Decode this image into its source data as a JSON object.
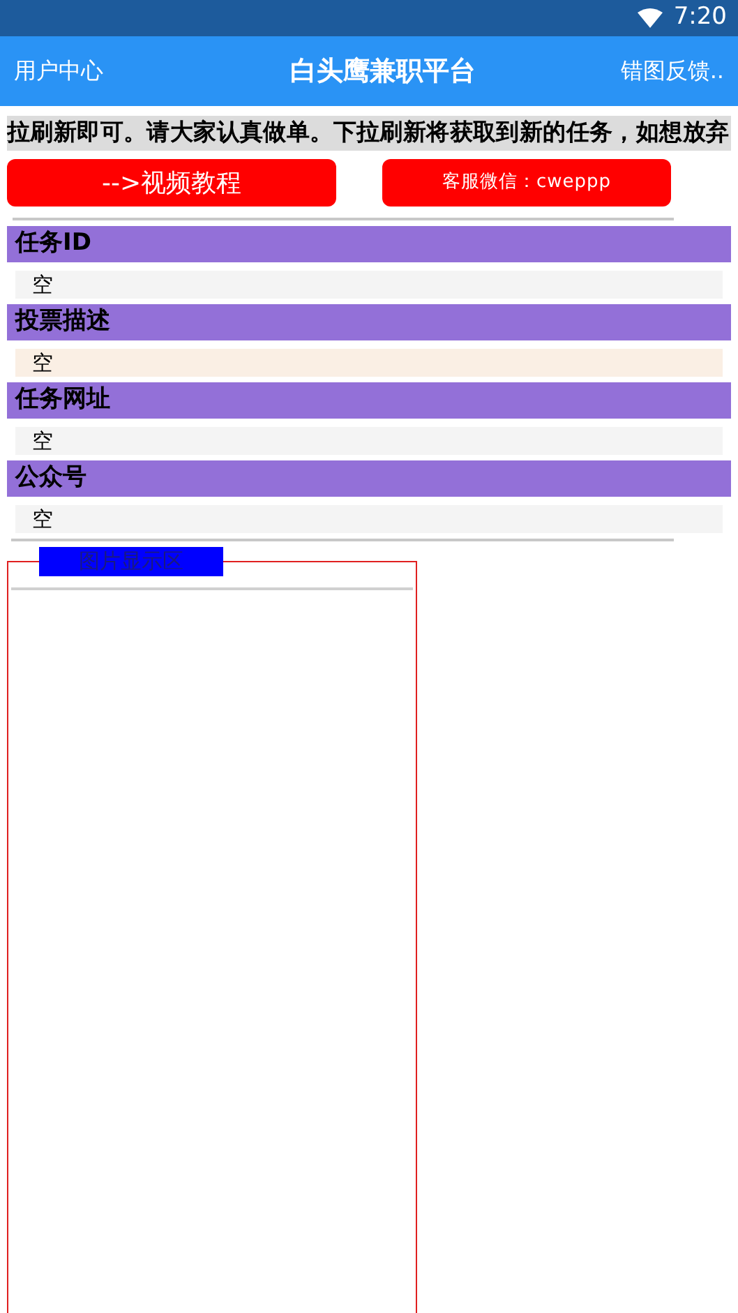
{
  "status_bar": {
    "time": "7:20"
  },
  "app_bar": {
    "left": "用户中心",
    "title": "白头鹰兼职平台",
    "right": "错图反馈.."
  },
  "notice": "拉刷新即可。请大家认真做单。下拉刷新将获取到新的任务，如想放弃",
  "buttons": [
    {
      "label": "-->视频教程",
      "kind": "large"
    },
    {
      "label": "客服微信：cweppp",
      "kind": "small"
    }
  ],
  "fields": [
    {
      "label": "任务ID",
      "value": "空",
      "color": "#f4f4f4"
    },
    {
      "label": "投票描述",
      "value": "空",
      "color": "#faefe4"
    },
    {
      "label": "任务网址",
      "value": "空",
      "color": "#f4f4f4"
    },
    {
      "label": "公众号",
      "value": "空",
      "color": "#f4f4f4"
    }
  ],
  "image_area": {
    "legend": "图片显示区"
  }
}
